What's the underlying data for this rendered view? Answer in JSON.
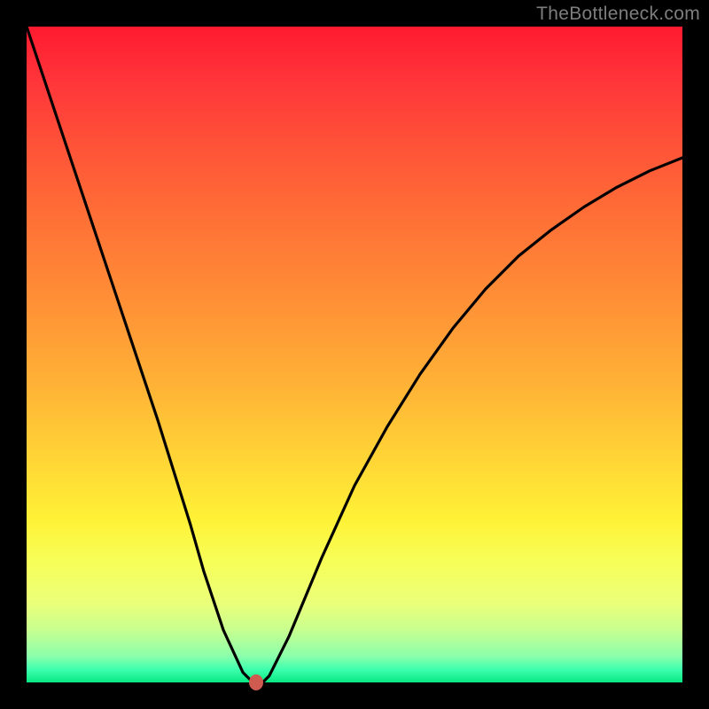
{
  "watermark": "TheBottleneck.com",
  "chart_data": {
    "type": "line",
    "title": "",
    "xlabel": "",
    "ylabel": "",
    "xlim": [
      0,
      100
    ],
    "ylim": [
      0,
      100
    ],
    "series": [
      {
        "name": "curve",
        "x": [
          0,
          5,
          10,
          15,
          20,
          25,
          27,
          30,
          33,
          34,
          35,
          36,
          37,
          40,
          45,
          50,
          55,
          60,
          65,
          70,
          75,
          80,
          85,
          90,
          95,
          100
        ],
        "y": [
          100,
          85,
          70,
          55,
          40,
          24,
          17,
          8,
          1.5,
          0.5,
          0,
          0,
          1,
          7,
          19,
          30,
          39,
          47,
          54,
          60,
          65,
          69,
          72.5,
          75.5,
          78,
          80
        ]
      }
    ],
    "marker": {
      "x": 35,
      "y": 0
    },
    "gradient_stops": [
      {
        "pos": 0,
        "color": "#ff1a2f"
      },
      {
        "pos": 50,
        "color": "#ffb336"
      },
      {
        "pos": 80,
        "color": "#fff136"
      },
      {
        "pos": 100,
        "color": "#08e884"
      }
    ]
  }
}
